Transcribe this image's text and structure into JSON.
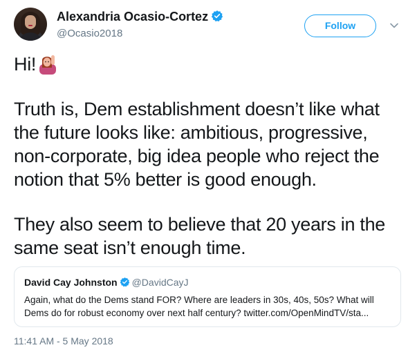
{
  "author": {
    "name": "Alexandria Ocasio-Cortez",
    "handle": "@Ocasio2018",
    "verified": true
  },
  "follow_button": {
    "label": "Follow"
  },
  "menu": {
    "icon": "chevron-down-icon"
  },
  "tweet": {
    "greeting": "Hi!",
    "greeting_emoji": "woman-raising-hand-emoji",
    "paragraph1": "Truth is, Dem establishment doesn’t like what the future looks like: ambitious, progressive, non-corporate, big idea people who reject the notion that 5% better is good enough.",
    "paragraph2": "They also seem to believe that 20 years in the same seat isn’t enough time."
  },
  "quoted_tweet": {
    "name": "David Cay Johnston",
    "handle": "@DavidCayJ",
    "verified": true,
    "text": "Again, what do the Dems stand FOR?  Where are leaders in 30s, 40s, 50s? What will Dems do for robust economy over next half century? twitter.com/OpenMindTV/sta..."
  },
  "timestamp": "11:41 AM - 5 May 2018",
  "colors": {
    "accent": "#1da1f2",
    "text": "#14171a",
    "secondary": "#657786",
    "border": "#e1e8ed"
  }
}
